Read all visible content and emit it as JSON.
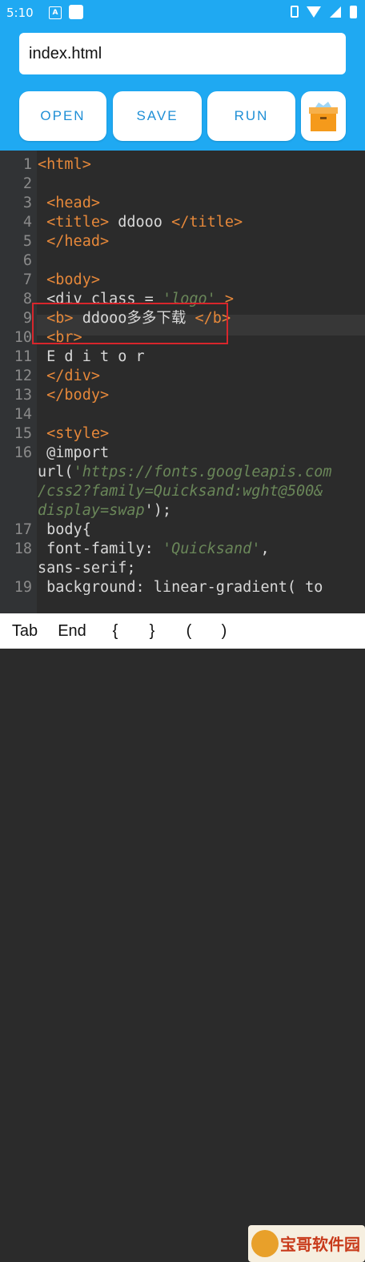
{
  "status_bar": {
    "time": "5:10",
    "notif_letter": "A"
  },
  "filename": {
    "value": "index.html"
  },
  "toolbar": {
    "open_label": "OPEN",
    "save_label": "SAVE",
    "run_label": "RUN"
  },
  "editor": {
    "lines": [
      {
        "n": "1",
        "text": "<html>"
      },
      {
        "n": "2",
        "text": ""
      },
      {
        "n": "3",
        "text": " <head>"
      },
      {
        "n": "4",
        "text": " <title> ddooo </title>"
      },
      {
        "n": "5",
        "text": " </head>"
      },
      {
        "n": "6",
        "text": ""
      },
      {
        "n": "7",
        "text": " <body>"
      },
      {
        "n": "8",
        "text": " <div class = 'logo' >"
      },
      {
        "n": "9",
        "text": " <b> ddooo多多下载 </b>"
      },
      {
        "n": "10",
        "text": " <br>"
      },
      {
        "n": "11",
        "text": " E d i t o r"
      },
      {
        "n": "12",
        "text": " </div>"
      },
      {
        "n": "13",
        "text": " </body>"
      },
      {
        "n": "14",
        "text": ""
      },
      {
        "n": "15",
        "text": " <style>"
      },
      {
        "n": "16",
        "text": " @import"
      },
      {
        "n": "",
        "text": "url('https://fonts.googleapis.com"
      },
      {
        "n": "",
        "text": "/css2?family=Quicksand:wght@500&"
      },
      {
        "n": "",
        "text": "display=swap');"
      },
      {
        "n": "17",
        "text": " body{"
      },
      {
        "n": "18",
        "text": " font-family: 'Quicksand',"
      },
      {
        "n": "",
        "text": "sans-serif;"
      },
      {
        "n": "19",
        "text": " background: linear-gradient( to"
      }
    ]
  },
  "keybar": {
    "keys": [
      "Tab",
      "End",
      "{",
      "}",
      "(",
      ")"
    ]
  },
  "watermark": {
    "text": "宝哥软件园"
  },
  "colors": {
    "header": "#1fa9f2",
    "button_text": "#1f8fd6",
    "tag": "#e6883a",
    "string": "#6a8759",
    "highlight_box": "#d8262c"
  }
}
